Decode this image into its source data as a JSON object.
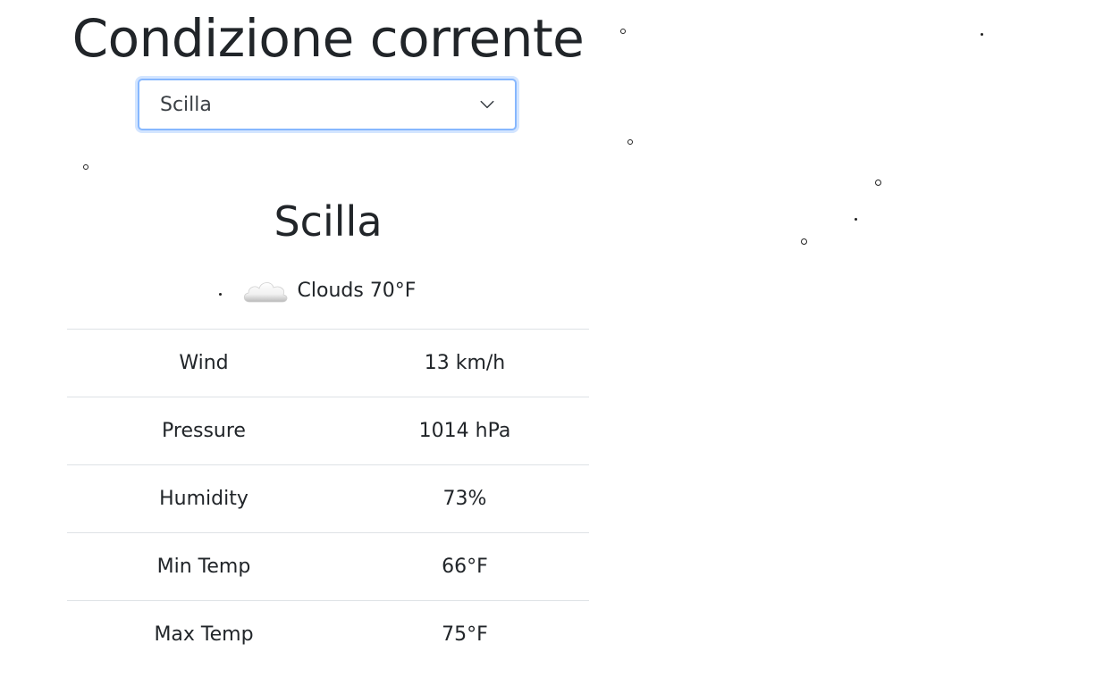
{
  "header": {
    "title": "Condizione corrente"
  },
  "city_select": {
    "selected": "Scilla",
    "icon": "chevron-down-icon"
  },
  "weather": {
    "city": "Scilla",
    "condition": "Clouds 70°F",
    "icon": "cloud-icon",
    "stats": [
      {
        "label": "Wind",
        "value": "13 km/h"
      },
      {
        "label": "Pressure",
        "value": "1014 hPa"
      },
      {
        "label": "Humidity",
        "value": "73%"
      },
      {
        "label": "Min Temp",
        "value": "66°F"
      },
      {
        "label": "Max Temp",
        "value": "75°F"
      }
    ]
  },
  "colors": {
    "focus_border": "#86b7fe",
    "text": "#212529",
    "divider": "#dee2e6"
  }
}
